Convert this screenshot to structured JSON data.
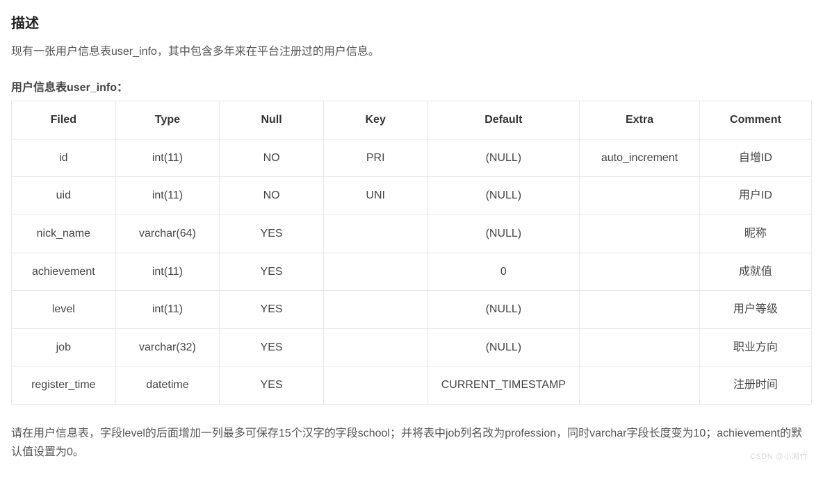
{
  "heading": "描述",
  "intro": "现有一张用户信息表user_info，其中包含多年来在平台注册过的用户信息。",
  "table_caption": "用户信息表user_info：",
  "table": {
    "headers": [
      "Filed",
      "Type",
      "Null",
      "Key",
      "Default",
      "Extra",
      "Comment"
    ],
    "rows": [
      {
        "filed": "id",
        "type": "int(11)",
        "null": "NO",
        "key": "PRI",
        "default": "(NULL)",
        "extra": "auto_increment",
        "comment": "自增ID"
      },
      {
        "filed": "uid",
        "type": "int(11)",
        "null": "NO",
        "key": "UNI",
        "default": "(NULL)",
        "extra": "",
        "comment": "用户ID"
      },
      {
        "filed": "nick_name",
        "type": "varchar(64)",
        "null": "YES",
        "key": "",
        "default": "(NULL)",
        "extra": "",
        "comment": "昵称"
      },
      {
        "filed": "achievement",
        "type": "int(11)",
        "null": "YES",
        "key": "",
        "default": "0",
        "extra": "",
        "comment": "成就值"
      },
      {
        "filed": "level",
        "type": "int(11)",
        "null": "YES",
        "key": "",
        "default": "(NULL)",
        "extra": "",
        "comment": "用户等级"
      },
      {
        "filed": "job",
        "type": "varchar(32)",
        "null": "YES",
        "key": "",
        "default": "(NULL)",
        "extra": "",
        "comment": "职业方向"
      },
      {
        "filed": "register_time",
        "type": "datetime",
        "null": "YES",
        "key": "",
        "default": "CURRENT_TIMESTAMP",
        "extra": "",
        "comment": "注册时间"
      }
    ]
  },
  "task": "请在用户信息表，字段level的后面增加一列最多可保存15个汉字的字段school；并将表中job列名改为profession，同时varchar字段长度变为10；achievement的默认值设置为0。",
  "watermark": "CSDN @小湘竹"
}
